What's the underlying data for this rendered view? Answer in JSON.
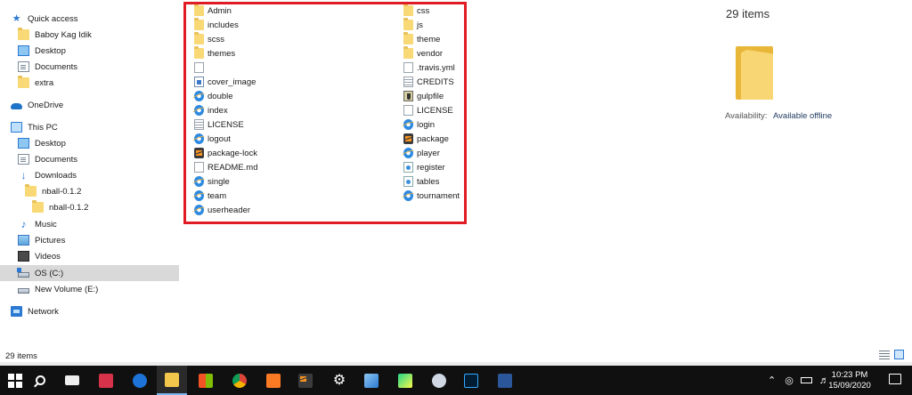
{
  "nav": {
    "items": [
      {
        "label": "Quick access",
        "icon": "star-icon"
      },
      {
        "label": "Baboy Kag Idik",
        "icon": "folder-icon"
      },
      {
        "label": "Desktop",
        "icon": "desktop-icon"
      },
      {
        "label": "Documents",
        "icon": "documents-icon"
      },
      {
        "label": "extra",
        "icon": "folder-icon"
      },
      {
        "label": "OneDrive",
        "icon": "cloud-icon"
      },
      {
        "label": "This PC",
        "icon": "computer-icon"
      },
      {
        "label": "Desktop",
        "icon": "desktop-icon"
      },
      {
        "label": "Documents",
        "icon": "documents-icon"
      },
      {
        "label": "Downloads",
        "icon": "download-icon"
      },
      {
        "label": "nball-0.1.2",
        "icon": "folder-icon"
      },
      {
        "label": "nball-0.1.2",
        "icon": "folder-icon"
      },
      {
        "label": "Music",
        "icon": "music-icon"
      },
      {
        "label": "Pictures",
        "icon": "pictures-icon"
      },
      {
        "label": "Videos",
        "icon": "videos-icon"
      },
      {
        "label": "OS (C:)",
        "icon": "drive-c-icon"
      },
      {
        "label": "New Volume (E:)",
        "icon": "drive-icon"
      },
      {
        "label": "Network",
        "icon": "network-icon"
      }
    ]
  },
  "files": {
    "left": [
      {
        "name": "Admin",
        "icon": "folder-icon"
      },
      {
        "name": "includes",
        "icon": "folder-icon"
      },
      {
        "name": "scss",
        "icon": "folder-icon"
      },
      {
        "name": "themes",
        "icon": "folder-icon"
      },
      {
        "name": "",
        "icon": "blank-file-icon"
      },
      {
        "name": "cover_image",
        "icon": "image-file-icon"
      },
      {
        "name": "double",
        "icon": "ie-file-icon"
      },
      {
        "name": "index",
        "icon": "ie-file-icon"
      },
      {
        "name": "LICENSE",
        "icon": "text-file-icon"
      },
      {
        "name": "logout",
        "icon": "ie-file-icon"
      },
      {
        "name": "package-lock",
        "icon": "sublime-file-icon"
      },
      {
        "name": "README.md",
        "icon": "blank-file-icon"
      },
      {
        "name": "single",
        "icon": "ie-file-icon"
      },
      {
        "name": "team",
        "icon": "ie-file-icon"
      },
      {
        "name": "userheader",
        "icon": "ie-file-icon"
      }
    ],
    "right": [
      {
        "name": "css",
        "icon": "folder-icon"
      },
      {
        "name": "js",
        "icon": "folder-icon"
      },
      {
        "name": "theme",
        "icon": "folder-icon"
      },
      {
        "name": "vendor",
        "icon": "folder-icon"
      },
      {
        "name": ".travis.yml",
        "icon": "blank-file-icon"
      },
      {
        "name": "CREDITS",
        "icon": "text-file-icon"
      },
      {
        "name": "gulpfile",
        "icon": "gulp-file-icon"
      },
      {
        "name": "LICENSE",
        "icon": "blank-file-icon"
      },
      {
        "name": "login",
        "icon": "ie-file-icon"
      },
      {
        "name": "package",
        "icon": "sublime-file-icon"
      },
      {
        "name": "player",
        "icon": "ie-file-icon"
      },
      {
        "name": "register",
        "icon": "html-file-icon"
      },
      {
        "name": "tables",
        "icon": "html-file-icon"
      },
      {
        "name": "tournament",
        "icon": "ie-file-icon"
      }
    ]
  },
  "details": {
    "count": "29 items",
    "availability_label": "Availability:",
    "availability_value": "Available offline"
  },
  "status": {
    "count": "29 items"
  },
  "taskbar": {
    "apps": [
      "start",
      "search",
      "mail",
      "gift",
      "edge",
      "file-explorer",
      "store",
      "chrome",
      "xampp",
      "sublime-text",
      "settings",
      "snip",
      "pycharm",
      "paint",
      "photoshop",
      "word"
    ],
    "time": "10:23 PM",
    "date": "15/09/2020"
  },
  "colors": {
    "highlight_box": "#e01b24",
    "selected_nav": "#d9d9d9",
    "taskbar": "#101010"
  }
}
